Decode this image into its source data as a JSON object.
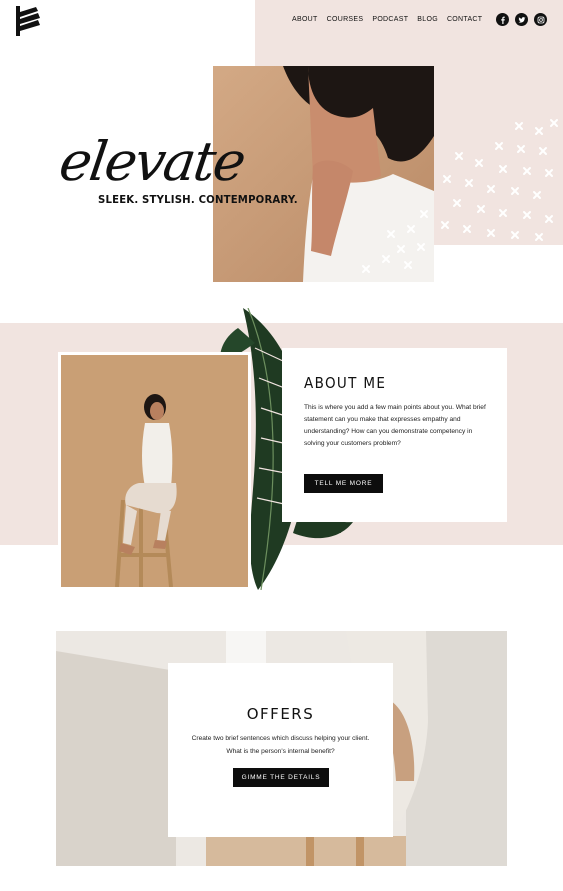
{
  "header": {
    "nav": [
      "ABOUT",
      "COURSES",
      "PODCAST",
      "BLOG",
      "CONTACT"
    ],
    "socials": [
      "facebook-icon",
      "twitter-icon",
      "instagram-icon"
    ]
  },
  "hero": {
    "script_title": "elevate",
    "tagline": "SLEEK. STYLISH. CONTEMPORARY."
  },
  "about": {
    "title": "ABOUT ME",
    "body": "This is where you add a few main points about you. What brief statement can you make that expresses empathy and understanding?  How can you demonstrate competency in solving your customers problem?",
    "button": "TELL ME MORE"
  },
  "offers": {
    "title": "OFFERS",
    "body_line1": "Create two brief sentences which discuss helping your client.",
    "body_line2": "What is the person's internal benefit?",
    "button": "GIMME THE DETAILS"
  },
  "colors": {
    "blush": "#f1e4e0",
    "button": "#0d0d0d",
    "photo_tan": "#c99f75"
  }
}
